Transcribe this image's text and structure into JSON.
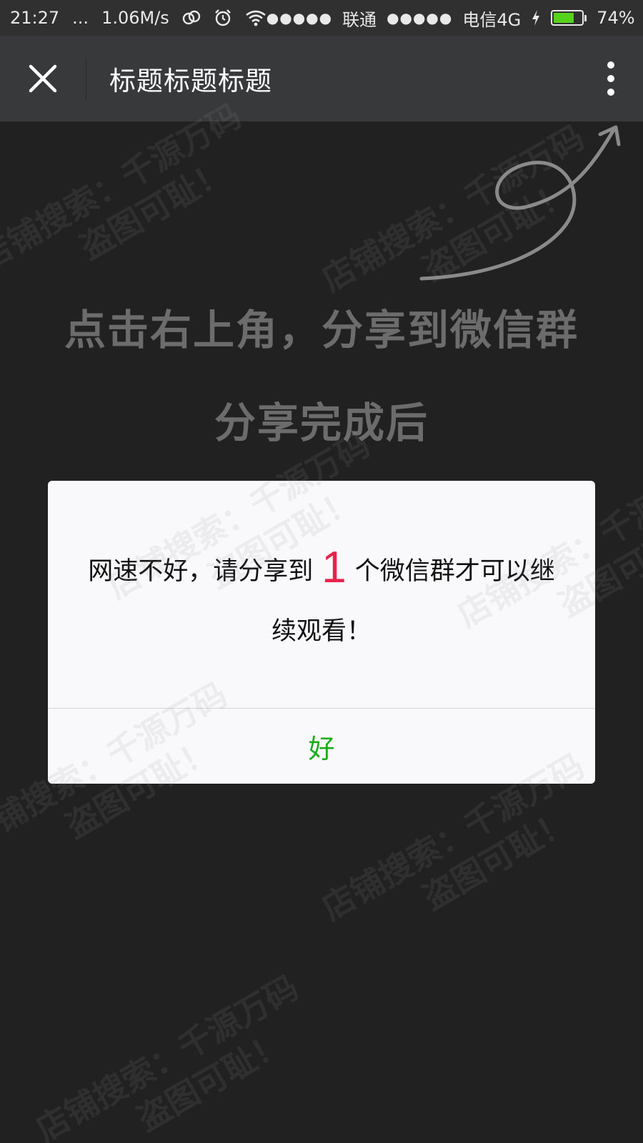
{
  "status_bar": {
    "time": "21:27",
    "dots": "...",
    "speed": "1.06M/s",
    "carrier1_signal": "●●●●●",
    "carrier1": "联通",
    "carrier2_signal": "●●●●●",
    "carrier2": "电信4G",
    "battery_percent": "74%",
    "battery_level": 0.74,
    "battery_color": "#55d21c"
  },
  "nav": {
    "title": "标题标题标题"
  },
  "content": {
    "hint_line1": "点击右上角，分享到微信群",
    "hint_line2": "分享完成后"
  },
  "dialog": {
    "message_before": "网速不好，请分享到",
    "count": "1",
    "message_after": "个微信群才可以继续观看！",
    "ok_label": "好",
    "count_color": "#e8224a",
    "ok_color": "#1aad19"
  },
  "watermark": {
    "line1": "店铺搜索：千源万码",
    "line2": "盗图可耻！"
  }
}
